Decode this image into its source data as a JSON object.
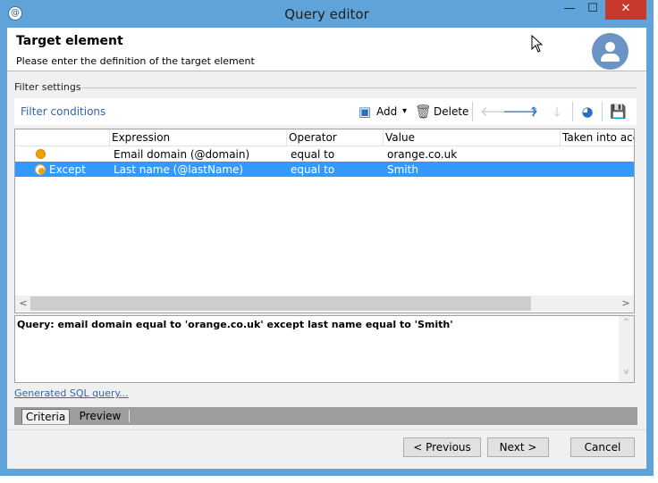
{
  "window": {
    "title": "Query editor",
    "min_glyph": "—",
    "max_glyph": "☐",
    "close_glyph": "✕",
    "app_icon_glyph": "@"
  },
  "header": {
    "title": "Target element",
    "subtitle": "Please enter the definition of the target element"
  },
  "filter_settings": {
    "label": "Filter settings"
  },
  "toolbar": {
    "filter_conditions": "Filter conditions",
    "add_label": "Add",
    "delete_label": "Delete",
    "add_dropdown_glyph": "▾",
    "icons": {
      "add": "add-icon",
      "delete": "trash-icon",
      "left": "arrow-left-icon",
      "right": "arrow-right-icon",
      "up": "arrow-up-icon",
      "down": "arrow-down-icon",
      "pie": "pie-chart-icon",
      "save": "save-icon"
    },
    "glyphs": {
      "left": "🡐",
      "right": "🡒",
      "up": "🡑",
      "down": "🡓",
      "delete": "🗑",
      "save": "💾",
      "pie": "◕",
      "add": "▣"
    }
  },
  "grid": {
    "columns": [
      "Expression",
      "Operator",
      "Value",
      "Taken into acco"
    ],
    "rows": [
      {
        "prefix": "",
        "expression": "Email domain (@domain)",
        "operator": "equal to",
        "value": "orange.co.uk",
        "selected": false
      },
      {
        "prefix": "Except",
        "expression": "Last name (@lastName)",
        "operator": "equal to",
        "value": "Smith",
        "selected": true
      }
    ],
    "scroll_left": "<",
    "scroll_right": ">"
  },
  "query": {
    "text": "Query: email domain equal to 'orange.co.uk' except last name equal to 'Smith'",
    "scroll_up": "^",
    "scroll_down": "v"
  },
  "sql_link": "Generated SQL query...",
  "tabs": [
    "Criteria",
    "Preview"
  ],
  "buttons": {
    "previous": "< Previous",
    "next": "Next >",
    "cancel": "Cancel"
  },
  "colors": {
    "accent": "#3399ff",
    "frame": "#5fa3d9",
    "close": "#c7392b",
    "link": "#3765a8",
    "status_dot": "#f0a000"
  }
}
